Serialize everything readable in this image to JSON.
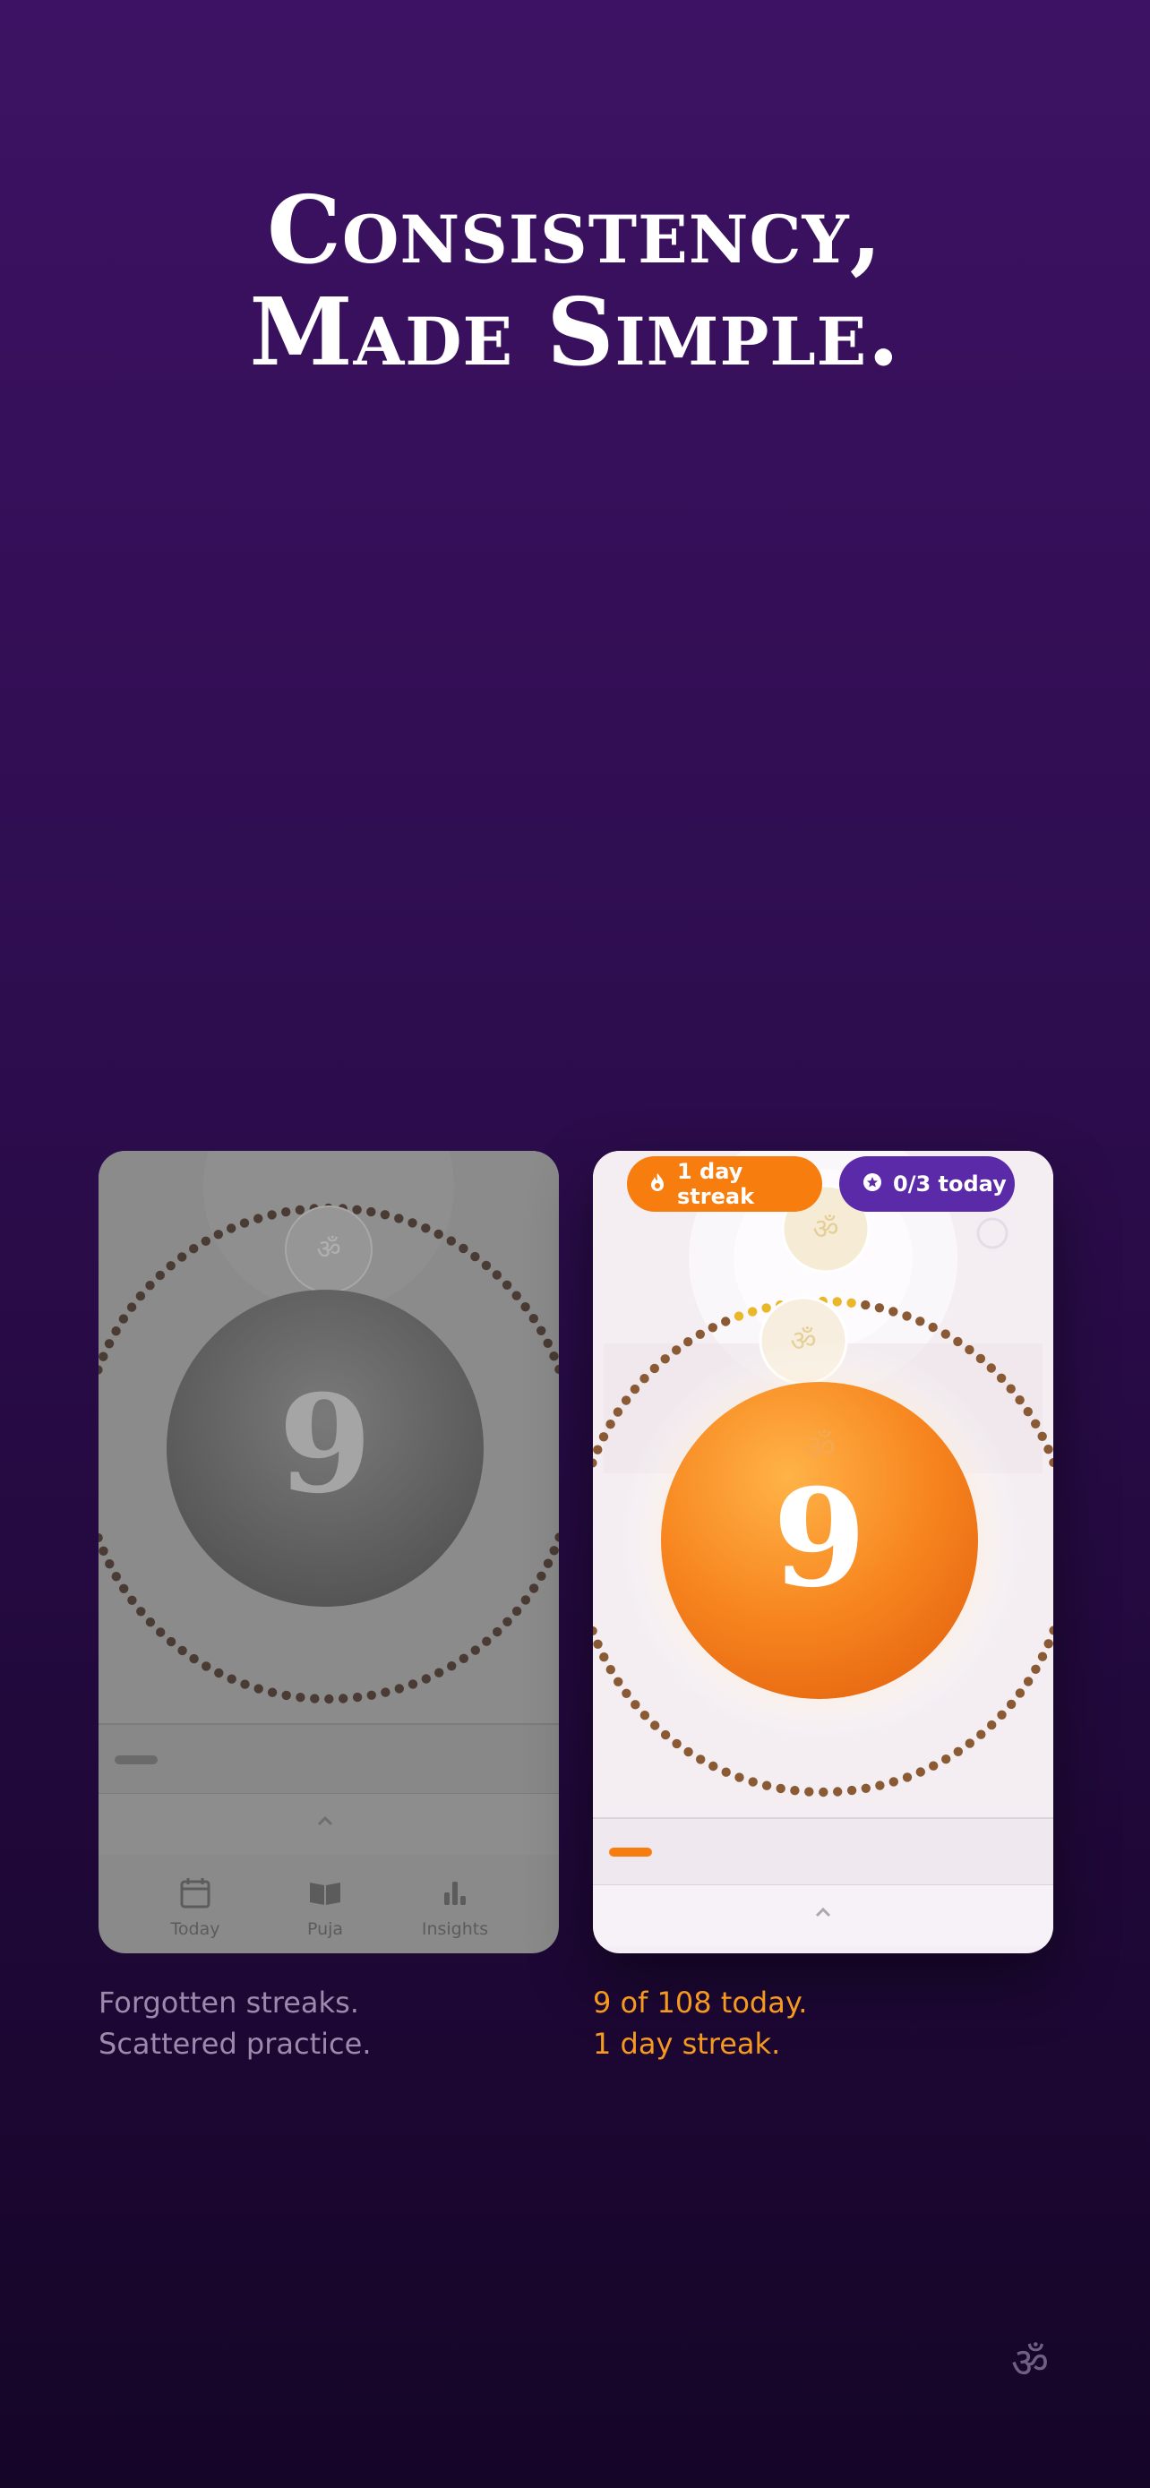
{
  "headline": {
    "line1": "Consistency,",
    "line2": "Made Simple."
  },
  "left_screen": {
    "counter_value": "9",
    "nav": [
      {
        "label": "Today",
        "icon": "calendar-icon"
      },
      {
        "label": "Puja",
        "icon": "book-icon"
      },
      {
        "label": "Insights",
        "icon": "bar-chart-icon"
      }
    ],
    "caption_line1": "Forgotten streaks.",
    "caption_line2": "Scattered practice."
  },
  "right_screen": {
    "streak_pill": "1 day streak",
    "today_pill": "0/3 today",
    "counter_value": "9",
    "caption_line1": "9 of 108 today.",
    "caption_line2": "1 day streak.",
    "progress_count": 9,
    "progress_total": 108
  },
  "colors": {
    "accent_orange": "#f77d0f",
    "accent_purple": "#5a2aa8",
    "background_top": "#3d1264",
    "background_bottom": "#150527"
  },
  "footer": {
    "logo_icon": "om-symbol-icon"
  }
}
